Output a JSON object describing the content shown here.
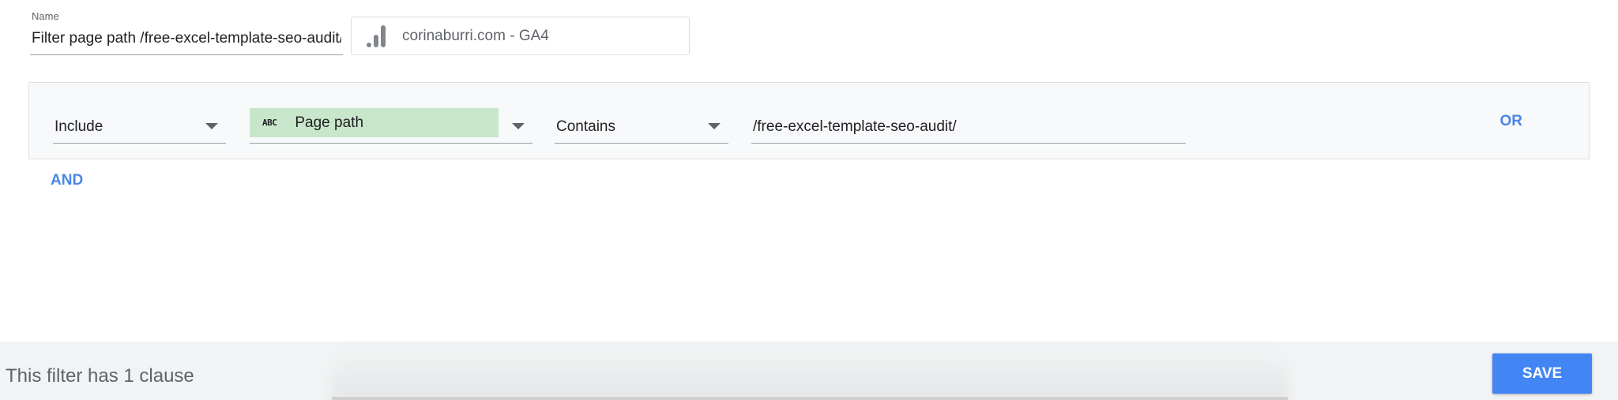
{
  "name": {
    "label": "Name",
    "value": "Filter page path /free-excel-template-seo-audit/"
  },
  "data_source": {
    "icon": "analytics-bars-icon",
    "label": "corinaburri.com - GA4"
  },
  "clause": {
    "condition": "Include",
    "field_type_badge": "ABC",
    "field": "Page path",
    "operator": "Contains",
    "value": "/free-excel-template-seo-audit/",
    "or_label": "OR"
  },
  "and_label": "AND",
  "footer": {
    "status": "This filter has 1 clause",
    "save_label": "SAVE"
  },
  "colors": {
    "accent": "#4285f4",
    "link": "#4a86e8",
    "field_chip": "#c8e6c9"
  }
}
